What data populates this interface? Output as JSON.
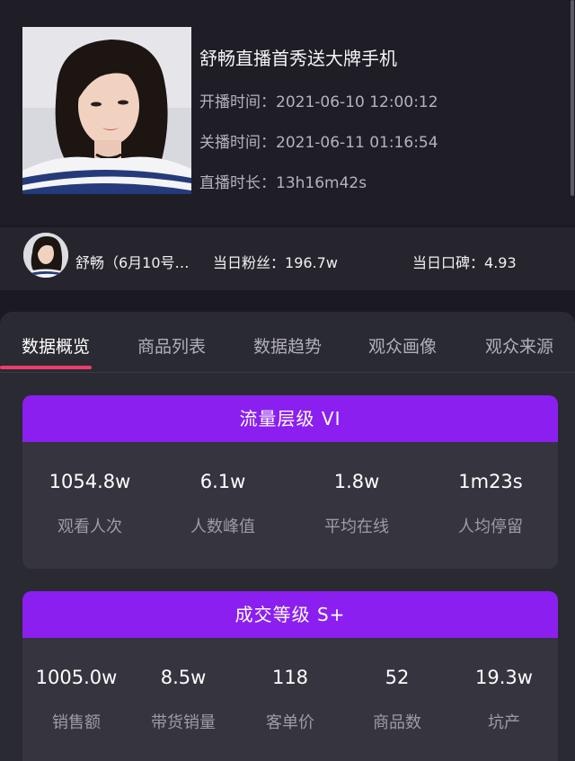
{
  "live": {
    "title": "舒畅直播首秀送大牌手机",
    "start_label": "开播时间：",
    "start_value": "2021-06-10 12:00:12",
    "end_label": "关播时间：",
    "end_value": "2021-06-11 01:16:54",
    "duration_label": "直播时长：",
    "duration_value": "13h16m42s"
  },
  "streamer": {
    "name": "舒畅（6月10号…",
    "fans_label": "当日粉丝：",
    "fans_value": "196.7w",
    "reputation_label": "当日口碑：",
    "reputation_value": "4.93"
  },
  "tabs": [
    {
      "label": "数据概览"
    },
    {
      "label": "商品列表"
    },
    {
      "label": "数据趋势"
    },
    {
      "label": "观众画像"
    },
    {
      "label": "观众来源"
    }
  ],
  "traffic": {
    "title": "流量层级 VI",
    "stats": [
      {
        "value": "1054.8w",
        "label": "观看人次"
      },
      {
        "value": "6.1w",
        "label": "人数峰值"
      },
      {
        "value": "1.8w",
        "label": "平均在线"
      },
      {
        "value": "1m23s",
        "label": "人均停留"
      }
    ]
  },
  "sales": {
    "title": "成交等级 S+",
    "stats": [
      {
        "value": "1005.0w",
        "label": "销售额"
      },
      {
        "value": "8.5w",
        "label": "带货销量"
      },
      {
        "value": "118",
        "label": "客单价"
      },
      {
        "value": "52",
        "label": "商品数"
      },
      {
        "value": "19.3w",
        "label": "坑产"
      }
    ]
  },
  "colors": {
    "accent_purple": "#8b1ff0",
    "tab_underline": "#ec3d6c",
    "background": "#1b1a22"
  }
}
